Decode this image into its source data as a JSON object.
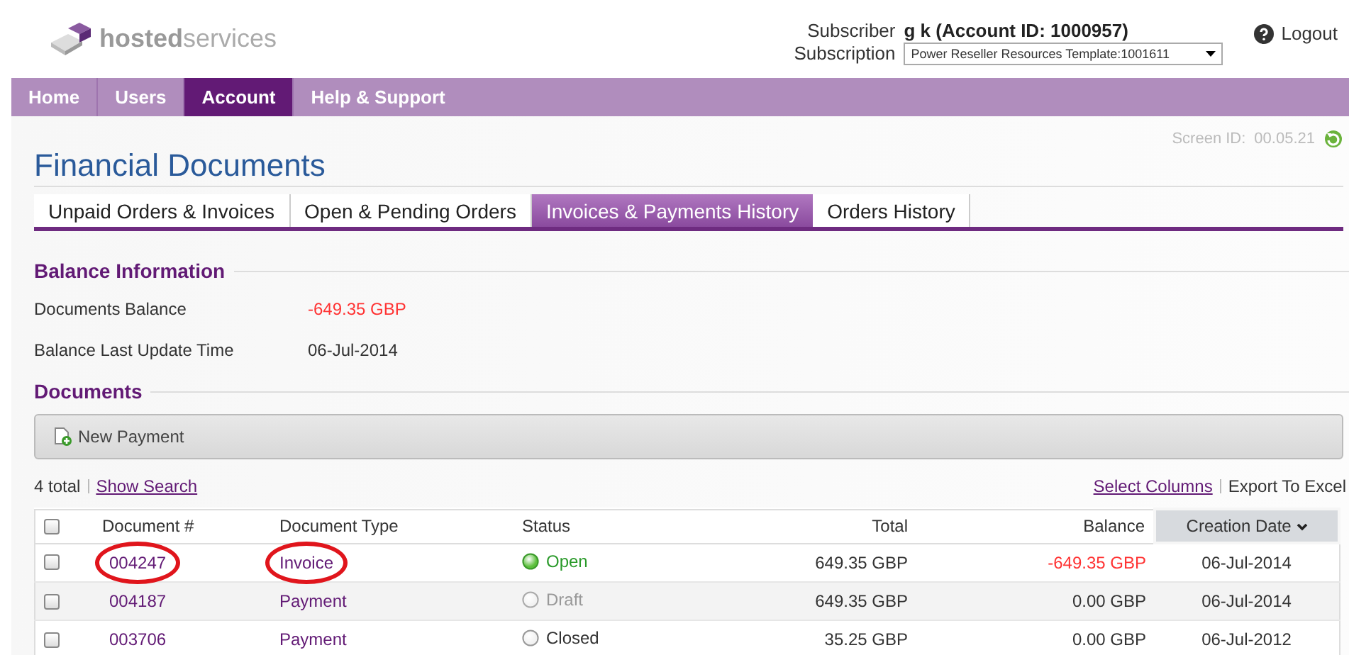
{
  "header": {
    "logo": {
      "bold": "hosted",
      "light": "services"
    },
    "subscriber_label": "Subscriber",
    "subscriber": "g k (Account ID: 1000957)",
    "subscription_label": "Subscription",
    "subscription": "Power Reseller Resources Template:1001611",
    "logout": "Logout"
  },
  "nav": [
    {
      "label": "Home",
      "selected": false
    },
    {
      "label": "Users",
      "selected": false
    },
    {
      "label": "Account",
      "selected": true
    },
    {
      "label": "Help & Support",
      "selected": false
    }
  ],
  "screen_id": {
    "label": "Screen ID:",
    "value": "00.05.21"
  },
  "title": "Financial Documents",
  "tabs": [
    {
      "label": "Unpaid Orders & Invoices",
      "selected": false
    },
    {
      "label": "Open & Pending Orders",
      "selected": false
    },
    {
      "label": "Invoices & Payments History",
      "selected": true
    },
    {
      "label": "Orders History",
      "selected": false
    }
  ],
  "balance": {
    "heading": "Balance Information",
    "rows": [
      {
        "label": "Documents Balance",
        "value": "-649.35 GBP",
        "negative": true
      },
      {
        "label": "Balance Last Update Time",
        "value": "06-Jul-2014",
        "negative": false
      }
    ]
  },
  "documents": {
    "heading": "Documents",
    "new_payment": "New Payment",
    "total": "4 total",
    "show_search": "Show Search",
    "select_columns": "Select Columns",
    "export": "Export To Excel",
    "select_all_checked": false,
    "columns": [
      "Document #",
      "Document Type",
      "Status",
      "Total",
      "Balance",
      "Creation Date"
    ],
    "rows": [
      {
        "checked": false,
        "number": "004247",
        "type": "Invoice",
        "status": "Open",
        "kind": "open",
        "total": "649.35 GBP",
        "balance": "-649.35 GBP",
        "negative": true,
        "date": "06-Jul-2014",
        "circled": true
      },
      {
        "checked": false,
        "number": "004187",
        "type": "Payment",
        "status": "Draft",
        "kind": "draft",
        "total": "649.35 GBP",
        "balance": "0.00 GBP",
        "negative": false,
        "date": "06-Jul-2014",
        "circled": false
      },
      {
        "checked": false,
        "number": "003706",
        "type": "Payment",
        "status": "Closed",
        "kind": "closed",
        "total": "35.25 GBP",
        "balance": "0.00 GBP",
        "negative": false,
        "date": "06-Jul-2012",
        "circled": false
      }
    ]
  }
}
